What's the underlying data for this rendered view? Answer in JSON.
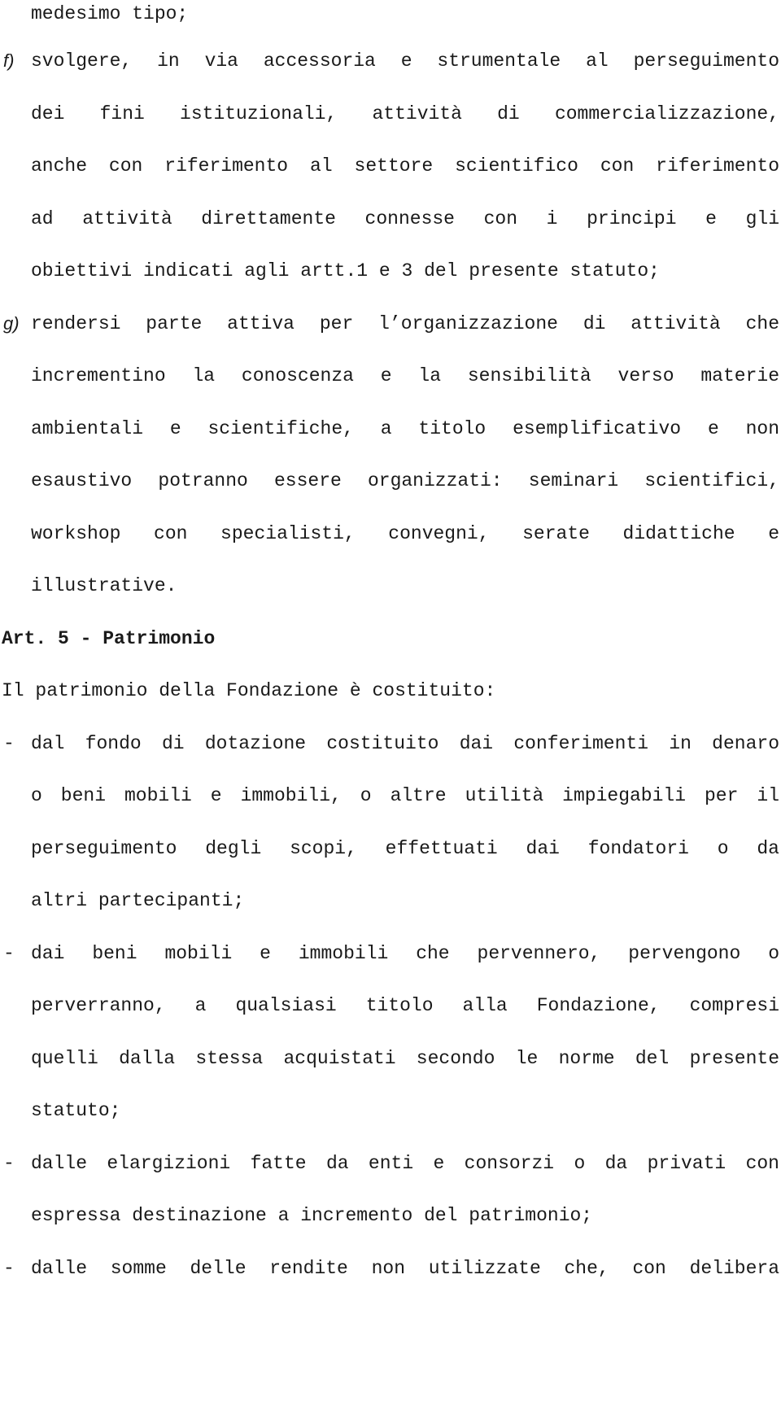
{
  "document": {
    "item_e_tail": "medesimo tipo;",
    "item_f": {
      "marker": "f)",
      "lines": [
        "svolgere, in via accessoria e strumentale al perseguimento",
        "dei fini istituzionali, attività di commercializzazione,",
        "anche con riferimento al settore scientifico con riferimento",
        "ad attività direttamente connesse con i principi e gli",
        "obiettivi indicati agli artt.1 e 3 del presente statuto;"
      ]
    },
    "item_g": {
      "marker": "g)",
      "lines": [
        "rendersi parte attiva per l’organizzazione di attività che",
        "incrementino la conoscenza e la sensibilità verso materie",
        "ambientali e scientifiche, a titolo esemplificativo e non",
        "esaustivo potranno essere organizzati: seminari scientifici,",
        "workshop con specialisti, convegni, serate didattiche e",
        "illustrative."
      ]
    },
    "article_heading": "Art. 5 - Patrimonio",
    "article_intro": "Il patrimonio della Fondazione è costituito:",
    "bullets": [
      {
        "marker": "-",
        "lines": [
          "dal fondo di dotazione costituito dai conferimenti in denaro",
          "o beni mobili e immobili, o altre utilità impiegabili per il",
          "perseguimento degli scopi, effettuati dai fondatori o da",
          "altri partecipanti;"
        ]
      },
      {
        "marker": "-",
        "lines": [
          "dai beni mobili e immobili che pervennero, pervengono o",
          "perverranno, a qualsiasi titolo alla Fondazione, compresi",
          "quelli dalla stessa acquistati secondo le norme del presente",
          "statuto;"
        ]
      },
      {
        "marker": "-",
        "lines": [
          "dalle elargizioni fatte da enti e consorzi o da privati con",
          "espressa destinazione a incremento del patrimonio;"
        ]
      },
      {
        "marker": "-",
        "lines": [
          "dalle somme delle rendite non utilizzate che, con delibera"
        ]
      }
    ]
  }
}
